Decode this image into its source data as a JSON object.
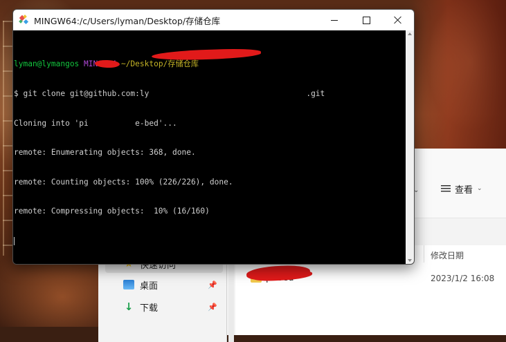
{
  "terminal": {
    "title": "MINGW64:/c/Users/lyman/Desktop/存储仓库",
    "prompt_user": "lyman@lymangos",
    "prompt_env": "MINGW64",
    "prompt_path": "~/Desktop/存储仓库",
    "lines": [
      "$ git clone git@github.com:ly",
      "Cloning into 'pi          e-bed'...",
      "remote: Enumerating objects: 368, done.",
      "remote: Counting objects: 100% (226/226), done.",
      "remote: Compressing objects:  10% (16/160)"
    ],
    "clone_line_tail": ".git",
    "colors": {
      "prompt_user": "#13c63e",
      "prompt_env": "#b048d8",
      "prompt_path": "#c4b326",
      "text": "#d0d0d0",
      "background": "#000000"
    }
  },
  "explorer": {
    "view_label": "查看",
    "column_date_header": "修改日期",
    "nav": [
      {
        "label": "快速访问",
        "icon": "star-icon"
      },
      {
        "label": "桌面",
        "icon": "desktop-icon"
      },
      {
        "label": "下载",
        "icon": "download-icon"
      }
    ],
    "file": {
      "name": "pi        bed",
      "date": "2023/1/2 16:08"
    }
  }
}
